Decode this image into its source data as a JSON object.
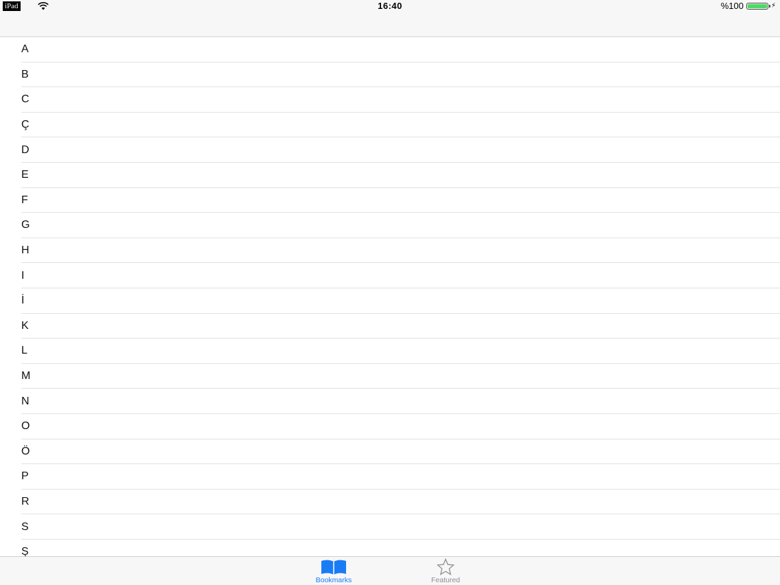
{
  "status_bar": {
    "carrier": "iPad",
    "time": "16:40",
    "battery_percent": "%100",
    "battery_level": 1.0,
    "battery_color": "#4cd964"
  },
  "letters": [
    "A",
    "B",
    "C",
    "Ç",
    "D",
    "E",
    "F",
    "G",
    "H",
    "I",
    "İ",
    "K",
    "L",
    "M",
    "N",
    "O",
    "Ö",
    "P",
    "R",
    "S",
    "Ş"
  ],
  "tabs": [
    {
      "label": "Bookmarks",
      "icon": "book-icon",
      "active": true
    },
    {
      "label": "Featured",
      "icon": "star-icon",
      "active": false
    }
  ],
  "colors": {
    "accent": "#1a7cf5",
    "inactive": "#8e8e93"
  }
}
